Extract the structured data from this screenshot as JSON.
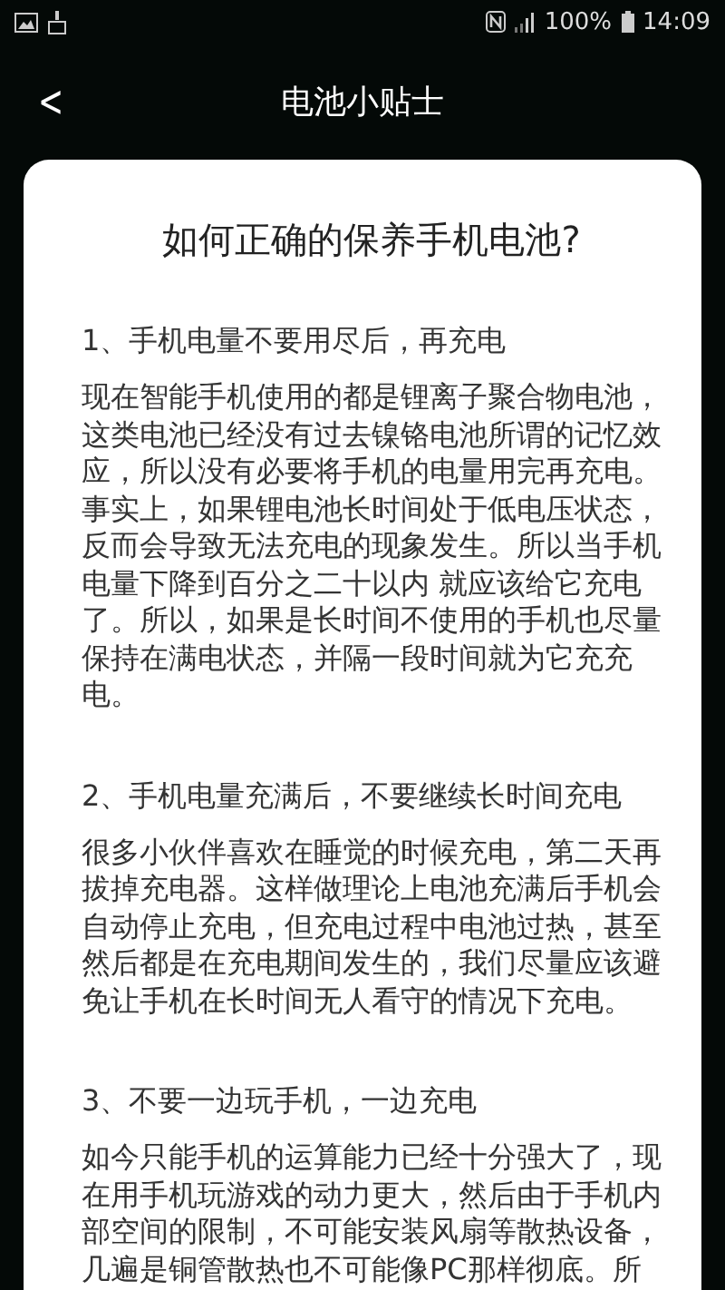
{
  "status_bar": {
    "battery_text": "100%",
    "time": "14:09"
  },
  "header": {
    "back": "<",
    "title": "电池小贴士"
  },
  "article": {
    "title": "如何正确的保养手机电池?",
    "sections": [
      {
        "heading": "1、手机电量不要用尽后，再充电",
        "body": "现在智能手机使用的都是锂离子聚合物电池，这类电池已经没有过去镍铬电池所谓的记忆效应，所以没有必要将手机的电量用完再充电。事实上，如果锂电池长时间处于低电压状态，反而会导致无法充电的现象发生。所以当手机电量下降到百分之二十以内 就应该给它充电了。所以，如果是长时间不使用的手机也尽量保持在满电状态，并隔一段时间就为它充充电。"
      },
      {
        "heading": "2、手机电量充满后，不要继续长时间充电",
        "body": "很多小伙伴喜欢在睡觉的时候充电，第二天再拔掉充电器。这样做理论上电池充满后手机会自动停止充电，但充电过程中电池过热，甚至然后都是在充电期间发生的，我们尽量应该避免让手机在长时间无人看守的情况下充电。"
      },
      {
        "heading": "3、不要一边玩手机，一边充电",
        "body": "如今只能手机的运算能力已经十分强大了，现在用手机玩游戏的动力更大，然后由于手机内部空间的限制，不可能安装风扇等散热设备，几遍是铜管散热也不可能像PC那样彻底。所"
      }
    ]
  }
}
